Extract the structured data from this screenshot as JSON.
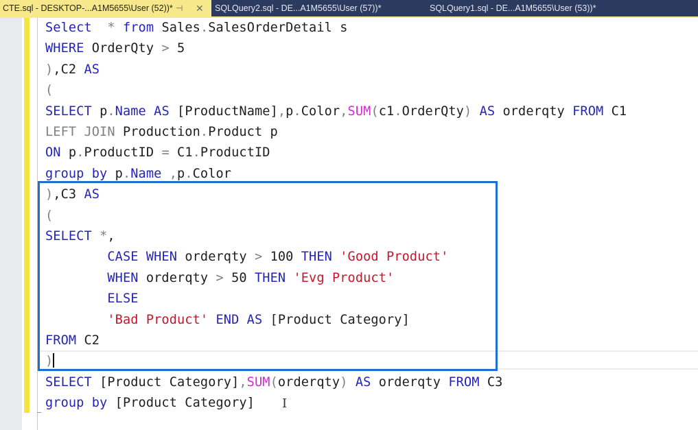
{
  "tabs": [
    {
      "label": "CTE.sql - DESKTOP-...A1M5655\\User (52))*",
      "active": true,
      "pin_icon": "pin-icon",
      "close_icon": "close-icon"
    },
    {
      "label": "SQLQuery2.sql - DE...A1M5655\\User (57))*",
      "active": false
    },
    {
      "label": "SQLQuery1.sql - DE...A1M5655\\User (53))*",
      "active": false
    }
  ],
  "colors": {
    "keyword": "#2424b8",
    "function": "#d12bd1",
    "string": "#c5162b",
    "operator": "#808080",
    "active_tab": "#f7e98b",
    "tab_bar": "#2b3a5e",
    "annotation_box": "#1f6fd0",
    "change_margin": "#f4e542"
  },
  "editor": {
    "lines": [
      [
        {
          "t": "Select",
          "c": "kw"
        },
        {
          "t": "  "
        },
        {
          "t": "*",
          "c": "gr"
        },
        {
          "t": " "
        },
        {
          "t": "from",
          "c": "kw"
        },
        {
          "t": " Sales"
        },
        {
          "t": ".",
          "c": "gr"
        },
        {
          "t": "SalesOrderDetail s"
        }
      ],
      [
        {
          "t": "WHERE",
          "c": "kw"
        },
        {
          "t": " OrderQty "
        },
        {
          "t": ">",
          "c": "gr"
        },
        {
          "t": " 5"
        }
      ],
      [
        {
          "t": ")",
          "c": "gr"
        },
        {
          "t": ",C2 "
        },
        {
          "t": "AS",
          "c": "kw"
        }
      ],
      [
        {
          "t": "(",
          "c": "gr"
        }
      ],
      [
        {
          "t": "SELECT",
          "c": "kw"
        },
        {
          "t": " p"
        },
        {
          "t": ".",
          "c": "gr"
        },
        {
          "t": "Name",
          "c": "kw"
        },
        {
          "t": " "
        },
        {
          "t": "AS",
          "c": "kw"
        },
        {
          "t": " [ProductName]"
        },
        {
          "t": ",",
          "c": "gr"
        },
        {
          "t": "p"
        },
        {
          "t": ".",
          "c": "gr"
        },
        {
          "t": "Color"
        },
        {
          "t": ",",
          "c": "gr"
        },
        {
          "t": "SUM",
          "c": "fn"
        },
        {
          "t": "(",
          "c": "gr"
        },
        {
          "t": "c1"
        },
        {
          "t": ".",
          "c": "gr"
        },
        {
          "t": "OrderQty"
        },
        {
          "t": ")",
          "c": "gr"
        },
        {
          "t": " "
        },
        {
          "t": "AS",
          "c": "kw"
        },
        {
          "t": " orderqty "
        },
        {
          "t": "FROM",
          "c": "kw"
        },
        {
          "t": " C1"
        }
      ],
      [
        {
          "t": "LEFT JOIN",
          "c": "gr"
        },
        {
          "t": " Production"
        },
        {
          "t": ".",
          "c": "gr"
        },
        {
          "t": "Product p"
        }
      ],
      [
        {
          "t": "ON",
          "c": "kw"
        },
        {
          "t": " p"
        },
        {
          "t": ".",
          "c": "gr"
        },
        {
          "t": "ProductID "
        },
        {
          "t": "=",
          "c": "gr"
        },
        {
          "t": " C1"
        },
        {
          "t": ".",
          "c": "gr"
        },
        {
          "t": "ProductID"
        }
      ],
      [
        {
          "t": "group by",
          "c": "kw"
        },
        {
          "t": " p"
        },
        {
          "t": ".",
          "c": "gr"
        },
        {
          "t": "Name",
          "c": "kw"
        },
        {
          "t": " "
        },
        {
          "t": ",",
          "c": "gr"
        },
        {
          "t": "p"
        },
        {
          "t": ".",
          "c": "gr"
        },
        {
          "t": "Color"
        }
      ],
      [
        {
          "t": ")",
          "c": "gr"
        },
        {
          "t": ",C3 "
        },
        {
          "t": "AS",
          "c": "kw"
        }
      ],
      [
        {
          "t": "(",
          "c": "gr"
        }
      ],
      [
        {
          "t": "SELECT",
          "c": "kw"
        },
        {
          "t": " "
        },
        {
          "t": "*",
          "c": "gr"
        },
        {
          "t": ","
        }
      ],
      [
        {
          "t": "        "
        },
        {
          "t": "CASE",
          "c": "kw"
        },
        {
          "t": " "
        },
        {
          "t": "WHEN",
          "c": "kw"
        },
        {
          "t": " orderqty "
        },
        {
          "t": ">",
          "c": "gr"
        },
        {
          "t": " 100 "
        },
        {
          "t": "THEN",
          "c": "kw"
        },
        {
          "t": " "
        },
        {
          "t": "'Good Product'",
          "c": "str"
        }
      ],
      [
        {
          "t": "        "
        },
        {
          "t": "WHEN",
          "c": "kw"
        },
        {
          "t": " orderqty "
        },
        {
          "t": ">",
          "c": "gr"
        },
        {
          "t": " 50 "
        },
        {
          "t": "THEN",
          "c": "kw"
        },
        {
          "t": " "
        },
        {
          "t": "'Evg Product'",
          "c": "str"
        }
      ],
      [
        {
          "t": "        "
        },
        {
          "t": "ELSE",
          "c": "kw"
        }
      ],
      [
        {
          "t": "        "
        },
        {
          "t": "'Bad Product'",
          "c": "str"
        },
        {
          "t": " "
        },
        {
          "t": "END",
          "c": "kw"
        },
        {
          "t": " "
        },
        {
          "t": "AS",
          "c": "kw"
        },
        {
          "t": " [Product Category]"
        }
      ],
      [
        {
          "t": "FROM",
          "c": "kw"
        },
        {
          "t": " C2"
        }
      ],
      [
        {
          "t": ")",
          "c": "gr"
        },
        {
          "caret": true
        }
      ],
      [
        {
          "t": "SELECT",
          "c": "kw"
        },
        {
          "t": " [Product Category]"
        },
        {
          "t": ",",
          "c": "gr"
        },
        {
          "t": "SUM",
          "c": "fn"
        },
        {
          "t": "(",
          "c": "gr"
        },
        {
          "t": "orderqty"
        },
        {
          "t": ")",
          "c": "gr"
        },
        {
          "t": " "
        },
        {
          "t": "AS",
          "c": "kw"
        },
        {
          "t": " orderqty "
        },
        {
          "t": "FROM",
          "c": "kw"
        },
        {
          "t": " C3"
        }
      ],
      [
        {
          "t": "group by",
          "c": "kw"
        },
        {
          "t": " [Product Category]"
        }
      ]
    ],
    "mouse_cursor": "I"
  }
}
